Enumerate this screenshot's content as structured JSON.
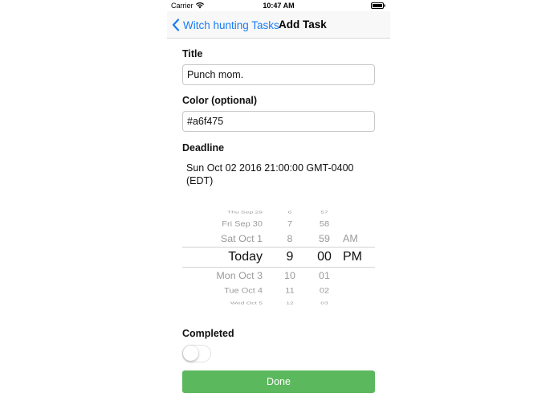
{
  "status_bar": {
    "carrier": "Carrier",
    "time": "10:47 AM",
    "wifi_icon": "wifi-icon",
    "battery_icon": "battery-icon"
  },
  "nav": {
    "back_label": "Witch hunting Tasks",
    "back_icon": "chevron-left-icon",
    "title": "Add Task",
    "accent_color": "#1a7cf5"
  },
  "form": {
    "title_label": "Title",
    "title_value": "Punch mom.",
    "color_label": "Color (optional)",
    "color_value": "#a6f475",
    "deadline_label": "Deadline",
    "deadline_value_line1": "Sun Oct 02 2016 21:00:00 GMT-0400",
    "deadline_value_line2": "(EDT)",
    "completed_label": "Completed",
    "completed": false,
    "done_label": "Done",
    "done_color": "#5cb85c"
  },
  "picker": {
    "days": [
      "Thu Sep 29",
      "Fri Sep 30",
      "Sat Oct 1",
      "Today",
      "Mon Oct 3",
      "Tue Oct 4",
      "Wed Oct 5"
    ],
    "hours": [
      "6",
      "7",
      "8",
      "9",
      "10",
      "11",
      "12"
    ],
    "minutes": [
      "57",
      "58",
      "59",
      "00",
      "01",
      "02",
      "03"
    ],
    "ampm": [
      "AM",
      "PM"
    ],
    "selected": {
      "day": "Today",
      "hour": "9",
      "minute": "00",
      "ampm": "PM"
    }
  }
}
